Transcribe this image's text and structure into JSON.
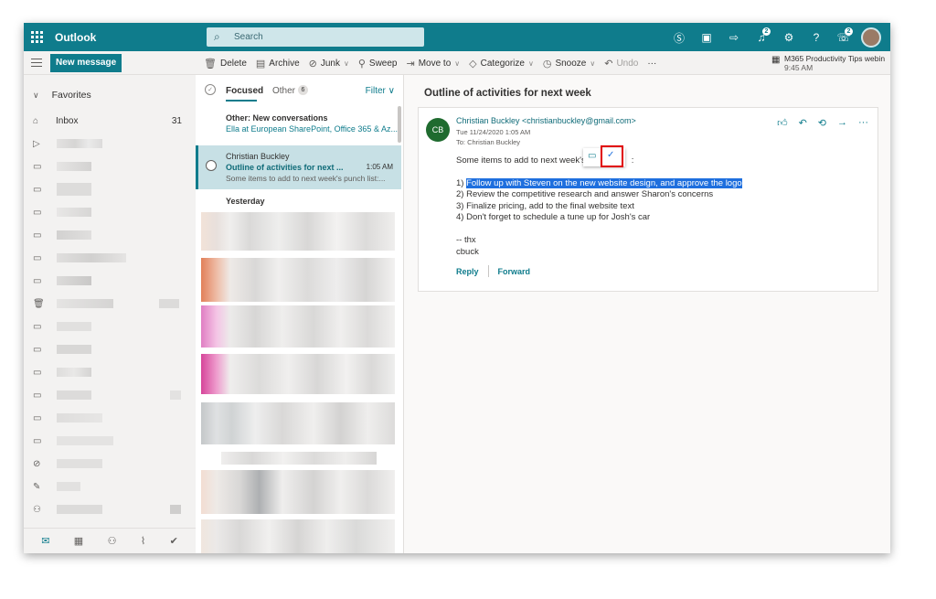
{
  "topbar": {
    "app_name": "Outlook",
    "search_placeholder": "Search",
    "icons": [
      "skype-icon",
      "office-icon",
      "todo-icon",
      "notifications-icon",
      "settings-icon",
      "help-icon",
      "feedback-icon"
    ],
    "notification_count": "2",
    "feedback_count": "2",
    "help_label": "?"
  },
  "commandbar": {
    "new_message": "New message",
    "delete": "Delete",
    "archive": "Archive",
    "junk": "Junk",
    "sweep": "Sweep",
    "move_to": "Move to",
    "categorize": "Categorize",
    "snooze": "Snooze",
    "undo": "Undo",
    "more": "···",
    "reminder_title": "M365 Productivity Tips webin",
    "reminder_time": "9:45 AM"
  },
  "leftnav": {
    "favorites": "Favorites",
    "inbox_label": "Inbox",
    "inbox_count": "31"
  },
  "messagelist": {
    "tab_focused": "Focused",
    "tab_other": "Other",
    "other_count": "6",
    "filter": "Filter",
    "other_conv_title": "Other: New conversations",
    "other_conv_from": "Ella at European SharePoint, Office 365 & Az...",
    "selected": {
      "sender": "Christian Buckley",
      "subject": "Outline of activities for next ...",
      "time": "1:05 AM",
      "preview": "Some items to add to next week's punch list:..."
    },
    "group_yesterday": "Yesterday"
  },
  "reading": {
    "subject": "Outline of activities for next week",
    "avatar_initials": "CB",
    "from": "Christian Buckley <christianbuckley@gmail.com>",
    "date": "Tue 11/24/2020 1:05 AM",
    "to": "To:  Christian Buckley",
    "intro": "Some items to add to next week's",
    "intro_end": ":",
    "item1_num": "1) ",
    "item1_hl": "Follow up with Steven on the new website design, and approve the logo",
    "item2": "2) Review the competitive research and answer Sharon's concerns",
    "item3": "3) Finalize pricing, add to the final website text",
    "item4": "4) Don't forget to schedule a tune up for Josh's car",
    "sign1": "-- thx",
    "sign2": "cbuck",
    "reply": "Reply",
    "forward": "Forward"
  },
  "colors": {
    "accent": "#0f7c8c",
    "selected_bg": "#c7e0e5",
    "highlight": "#1e6fde",
    "callout_border": "#e00000"
  }
}
